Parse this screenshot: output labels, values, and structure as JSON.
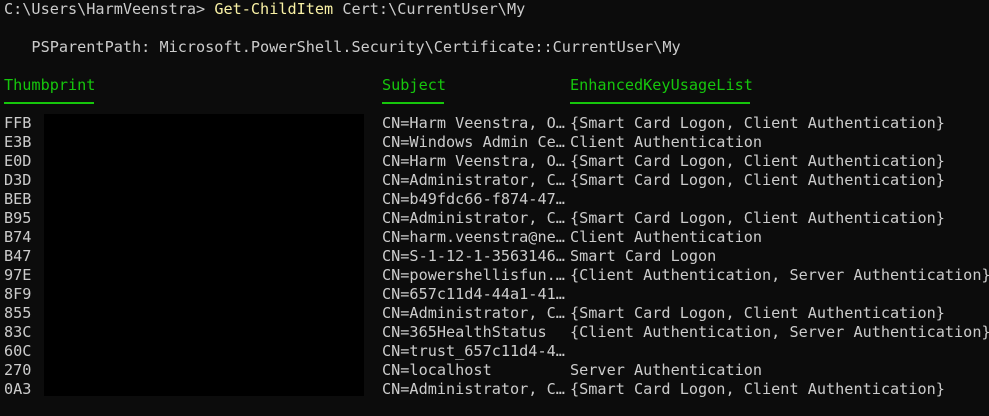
{
  "prompt": {
    "path": "C:\\Users\\HarmVeenstra>",
    "command": "Get-ChildItem",
    "argument": "Cert:\\CurrentUser\\My"
  },
  "parent_path_line": "   PSParentPath: Microsoft.PowerShell.Security\\Certificate::CurrentUser\\My",
  "table": {
    "headers": [
      "Thumbprint",
      "Subject",
      "EnhancedKeyUsageList"
    ],
    "rows": [
      {
        "thumbprint": "FFB",
        "subject": "CN=Harm Veenstra, O…",
        "eku": "{Smart Card Logon, Client Authentication}"
      },
      {
        "thumbprint": "E3B",
        "subject": "CN=Windows Admin Ce…",
        "eku": "Client Authentication"
      },
      {
        "thumbprint": "E0D",
        "subject": "CN=Harm Veenstra, O…",
        "eku": "{Smart Card Logon, Client Authentication}"
      },
      {
        "thumbprint": "D3D",
        "subject": "CN=Administrator, C…",
        "eku": "{Smart Card Logon, Client Authentication}"
      },
      {
        "thumbprint": "BEB",
        "subject": "CN=b49fdc66-f874-47…",
        "eku": ""
      },
      {
        "thumbprint": "B95",
        "subject": "CN=Administrator, C…",
        "eku": "{Smart Card Logon, Client Authentication}"
      },
      {
        "thumbprint": "B74",
        "subject": "CN=harm.veenstra@ne…",
        "eku": "Client Authentication"
      },
      {
        "thumbprint": "B47",
        "subject": "CN=S-1-12-1-3563146…",
        "eku": "Smart Card Logon"
      },
      {
        "thumbprint": "97E",
        "subject": "CN=powershellisfun.…",
        "eku": "{Client Authentication, Server Authentication}"
      },
      {
        "thumbprint": "8F9",
        "subject": "CN=657c11d4-44a1-41…",
        "eku": ""
      },
      {
        "thumbprint": "855",
        "subject": "CN=Administrator, C…",
        "eku": "{Smart Card Logon, Client Authentication}"
      },
      {
        "thumbprint": "83C",
        "subject": "CN=365HealthStatus",
        "eku": "{Client Authentication, Server Authentication}"
      },
      {
        "thumbprint": "60C",
        "subject": "CN=trust_657c11d4-4…",
        "eku": ""
      },
      {
        "thumbprint": "270",
        "subject": "CN=localhost",
        "eku": "Server Authentication"
      },
      {
        "thumbprint": "0A3",
        "subject": "CN=Administrator, C…",
        "eku": "{Smart Card Logon, Client Authentication}"
      }
    ]
  },
  "colors": {
    "background": "#0c0c0c",
    "foreground": "#cccccc",
    "command": "#f9f1a5",
    "header": "#16c60c",
    "redaction": "#000000"
  }
}
